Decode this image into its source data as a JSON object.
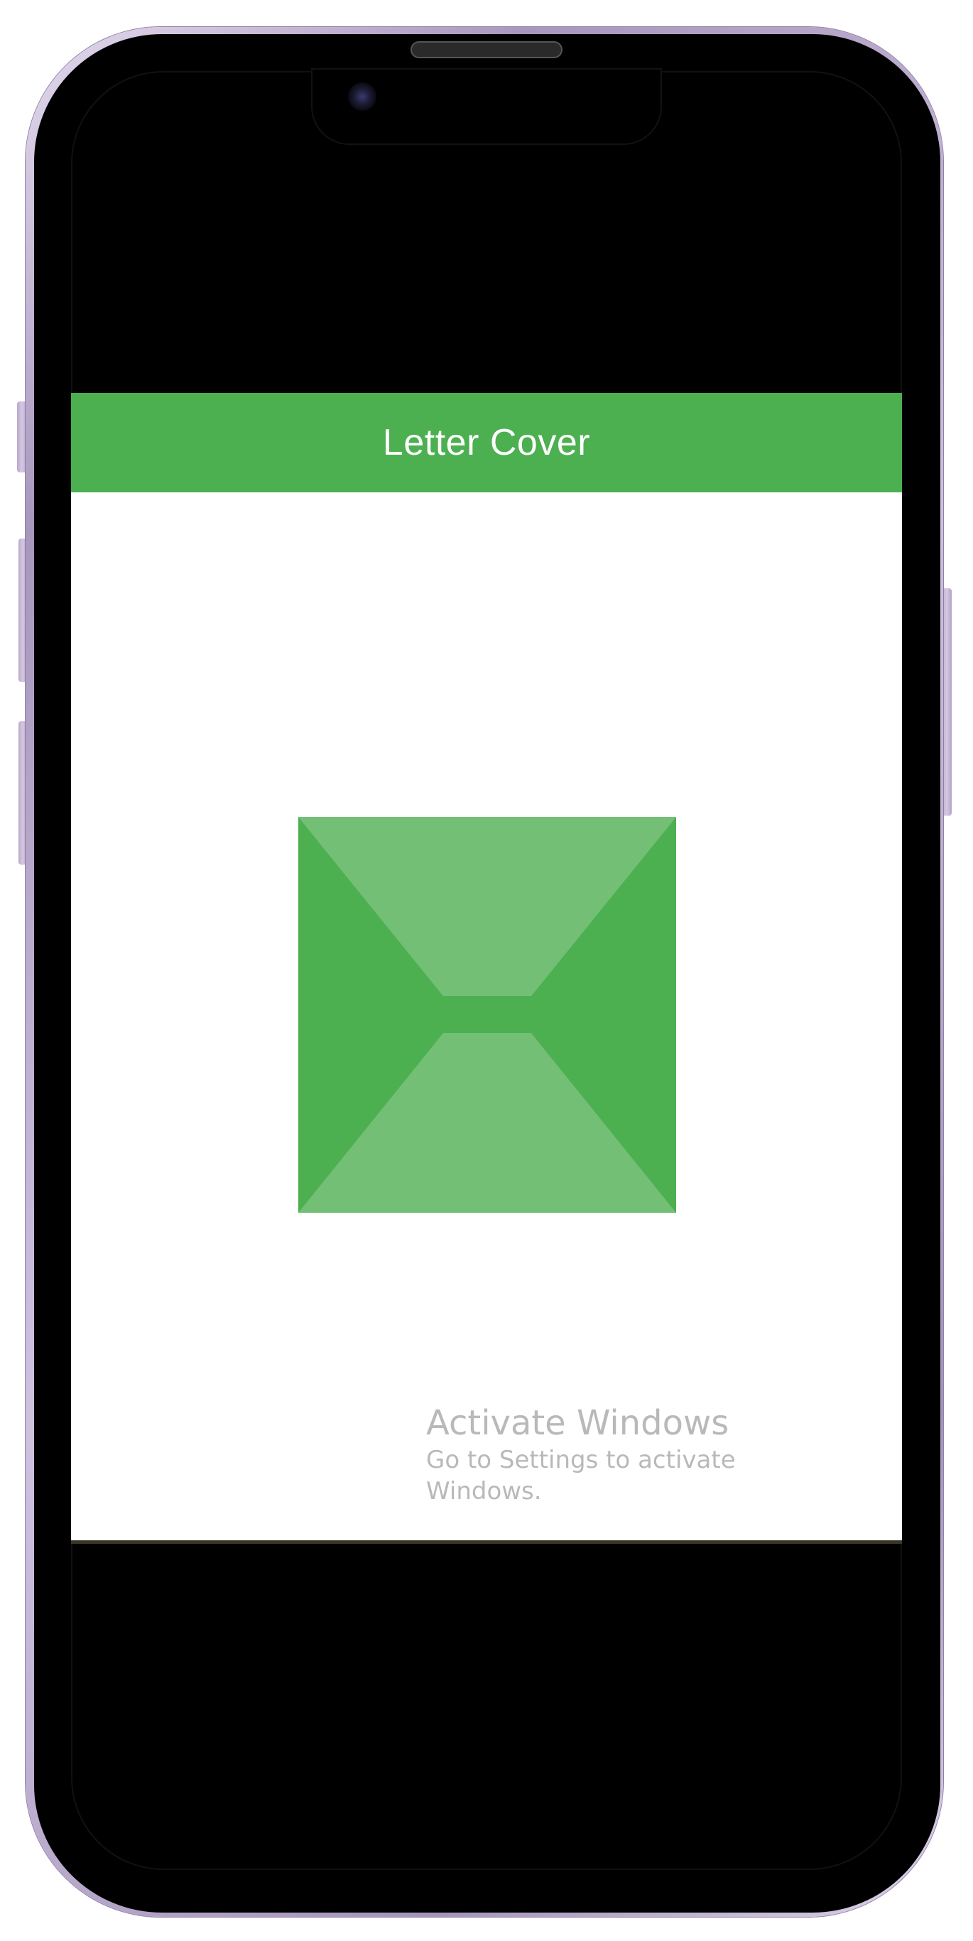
{
  "app": {
    "title": "Letter Cover",
    "accent_color": "#4caf50",
    "accent_light_color": "#72bf75",
    "background_color": "#ffffff"
  },
  "envelope": {
    "icon": "envelope-icon"
  },
  "watermark": {
    "title": "Activate Windows",
    "subtitle": "Go to Settings to activate Windows."
  },
  "device": {
    "frame_color": "#c5b6d8",
    "screen_color": "#000000"
  }
}
